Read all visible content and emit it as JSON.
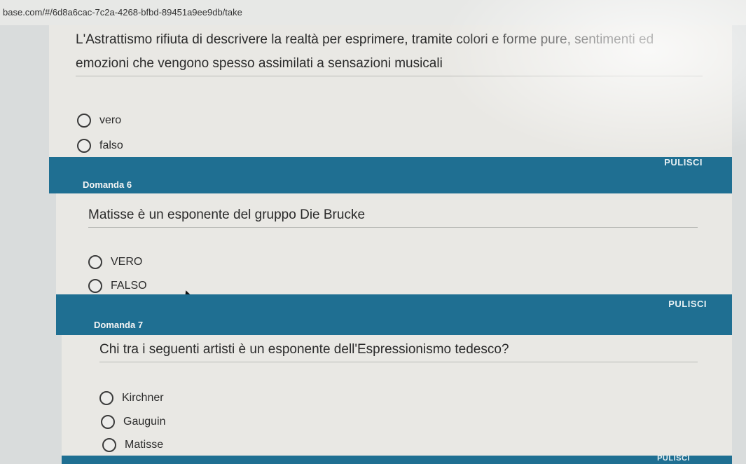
{
  "browser": {
    "url": "base.com/#/6d8a6cac-7c2a-4268-bfbd-89451a9ee9db/take"
  },
  "questions": [
    {
      "text_line1": "L'Astrattismo rifiuta di descrivere la realtà per esprimere, tramite colori e forme pure, sentimenti ed",
      "text_line2": "emozioni che vengono spesso assimilati a sensazioni musicali",
      "options": [
        "vero",
        "falso"
      ],
      "clear_label": "PULISCI"
    },
    {
      "heading": "Domanda 6",
      "text": "Matisse è un esponente del gruppo Die Brucke",
      "options": [
        "VERO",
        "FALSO"
      ],
      "clear_label": "PULISCI"
    },
    {
      "heading": "Domanda 7",
      "text": "Chi tra i seguenti artisti è un esponente dell'Espressionismo tedesco?",
      "options": [
        "Kirchner",
        "Gauguin",
        "Matisse"
      ],
      "clear_label": "PULISCI"
    }
  ],
  "colors": {
    "header_bar": "#1f6f92",
    "card_bg": "#e9e8e4"
  }
}
